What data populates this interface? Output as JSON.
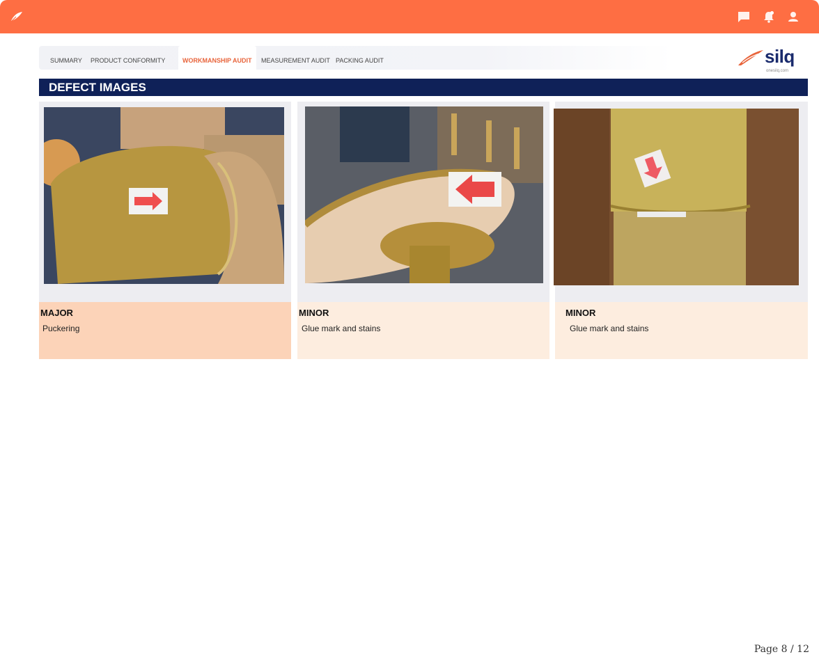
{
  "topbar": {
    "icons": [
      "leaf-logo-icon",
      "chat-icon",
      "notification-bell-icon",
      "user-icon"
    ],
    "accent": "#fe6e43"
  },
  "tabs": [
    {
      "label": "SUMMARY",
      "active": false
    },
    {
      "label": "PRODUCT CONFORMITY",
      "active": false
    },
    {
      "label": "WORKMANSHIP AUDIT",
      "active": true
    },
    {
      "label": "MEASUREMENT AUDIT",
      "active": false
    },
    {
      "label": "PACKING AUDIT",
      "active": false
    }
  ],
  "brand": {
    "name": "silq",
    "url": "onesilq.com",
    "color": "#1a2b6d"
  },
  "section": {
    "title": "DEFECT IMAGES",
    "color": "#0f2158"
  },
  "defects": [
    {
      "severity": "MAJOR",
      "description": "Puckering",
      "bg": "#fcd3b8"
    },
    {
      "severity": "MINOR",
      "description": "Glue mark and stains",
      "bg": "#fdeddf"
    },
    {
      "severity": "MINOR",
      "description": "Glue mark and stains",
      "bg": "#fdeddf"
    }
  ],
  "pager": {
    "text": "Page 8 / 12"
  }
}
